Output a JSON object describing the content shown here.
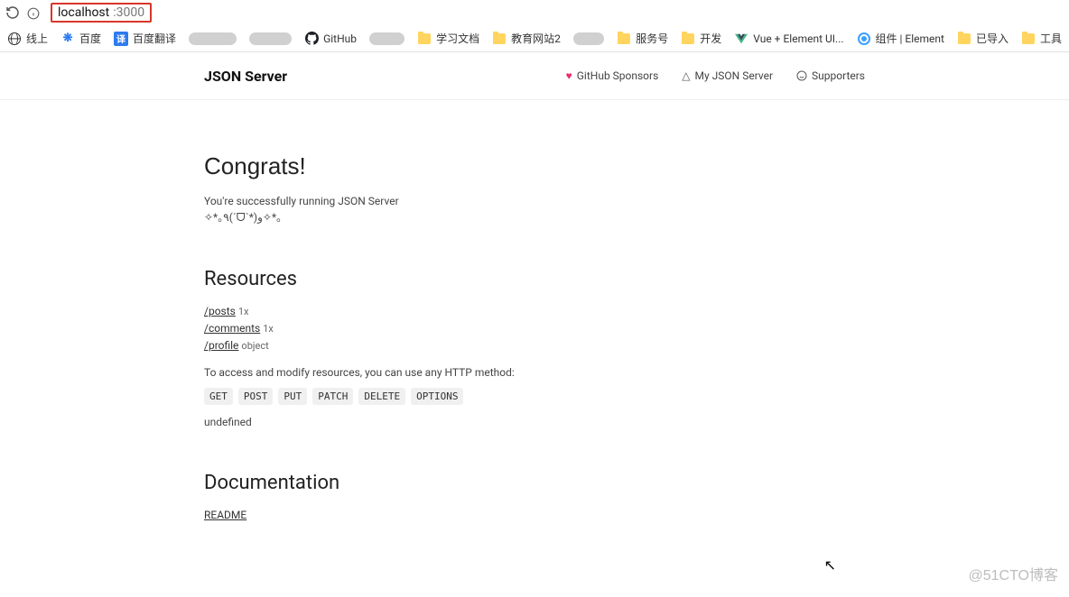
{
  "address": {
    "host": "localhost",
    "port": ":3000"
  },
  "bookmarks": {
    "b1": "线上",
    "b2": "百度",
    "b3": "百度翻译",
    "b4": "GitHub",
    "b5": "学习文档",
    "b6": "教育网站2",
    "b7": "服务号",
    "b8": "开发",
    "b9": "Vue + Element UI...",
    "b10": "组件 | Element",
    "b11": "已导入",
    "b12": "工具"
  },
  "header": {
    "title": "JSON Server",
    "links": {
      "sponsors": "GitHub Sponsors",
      "myjson": "My JSON Server",
      "supporters": "Supporters"
    }
  },
  "content": {
    "congrats_title": "Congrats!",
    "congrats_sub1": "You're successfully running JSON Server",
    "congrats_sub2": "✧*｡٩(ˊᗜˋ*)و✧*｡",
    "resources_title": "Resources",
    "resources": [
      {
        "path": "/posts",
        "count": "1x"
      },
      {
        "path": "/comments",
        "count": "1x"
      },
      {
        "path": "/profile",
        "count": "object"
      }
    ],
    "access_line": "To access and modify resources, you can use any HTTP method:",
    "methods": [
      "GET",
      "POST",
      "PUT",
      "PATCH",
      "DELETE",
      "OPTIONS"
    ],
    "undefined_text": "undefined",
    "documentation_title": "Documentation",
    "readme": "README"
  },
  "watermark": "@51CTO博客"
}
